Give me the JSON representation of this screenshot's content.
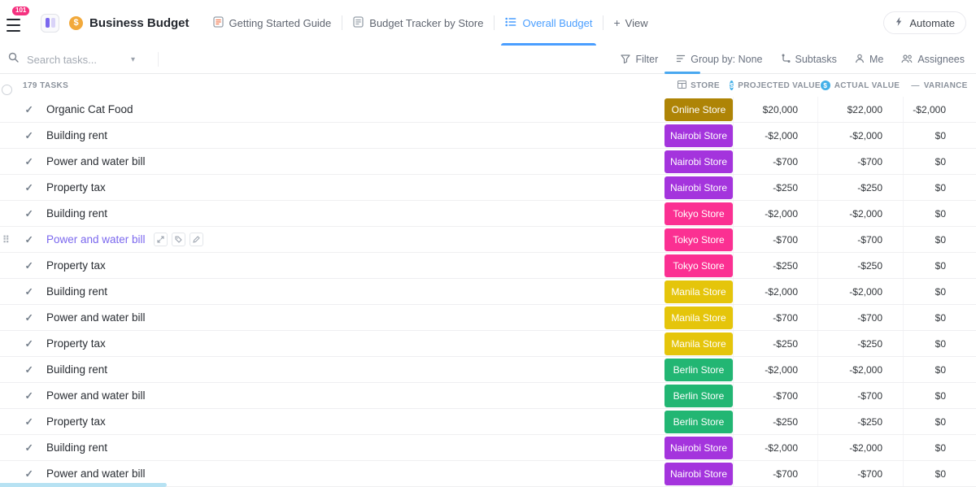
{
  "topbar": {
    "notifications_badge": "101",
    "workspace_title": "Business Budget",
    "tabs": [
      {
        "label": "Getting Started Guide"
      },
      {
        "label": "Budget Tracker by Store"
      },
      {
        "label": "Overall Budget"
      }
    ],
    "view_label": "View",
    "automate_label": "Automate"
  },
  "toolbar": {
    "search_placeholder": "Search tasks...",
    "filter_label": "Filter",
    "group_by_label": "Group by: None",
    "subtasks_label": "Subtasks",
    "me_label": "Me",
    "assignees_label": "Assignees"
  },
  "table": {
    "tasks_count": "179 TASKS",
    "columns": {
      "store": "STORE",
      "projected": "PROJECTED VALUE",
      "actual": "ACTUAL VALUE",
      "variance": "VARIANCE"
    },
    "rows": [
      {
        "name": "Organic Cat Food",
        "store": "Online Store",
        "projected": "$20,000",
        "actual": "$22,000",
        "variance": "-$2,000"
      },
      {
        "name": "Building rent",
        "store": "Nairobi Store",
        "projected": "-$2,000",
        "actual": "-$2,000",
        "variance": "$0"
      },
      {
        "name": "Power and water bill",
        "store": "Nairobi Store",
        "projected": "-$700",
        "actual": "-$700",
        "variance": "$0"
      },
      {
        "name": "Property tax",
        "store": "Nairobi Store",
        "projected": "-$250",
        "actual": "-$250",
        "variance": "$0"
      },
      {
        "name": "Building rent",
        "store": "Tokyo Store",
        "projected": "-$2,000",
        "actual": "-$2,000",
        "variance": "$0"
      },
      {
        "name": "Power and water bill",
        "store": "Tokyo Store",
        "projected": "-$700",
        "actual": "-$700",
        "variance": "$0",
        "highlighted": true
      },
      {
        "name": "Property tax",
        "store": "Tokyo Store",
        "projected": "-$250",
        "actual": "-$250",
        "variance": "$0"
      },
      {
        "name": "Building rent",
        "store": "Manila Store",
        "projected": "-$2,000",
        "actual": "-$2,000",
        "variance": "$0"
      },
      {
        "name": "Power and water bill",
        "store": "Manila Store",
        "projected": "-$700",
        "actual": "-$700",
        "variance": "$0"
      },
      {
        "name": "Property tax",
        "store": "Manila Store",
        "projected": "-$250",
        "actual": "-$250",
        "variance": "$0"
      },
      {
        "name": "Building rent",
        "store": "Berlin Store",
        "projected": "-$2,000",
        "actual": "-$2,000",
        "variance": "$0"
      },
      {
        "name": "Power and water bill",
        "store": "Berlin Store",
        "projected": "-$700",
        "actual": "-$700",
        "variance": "$0"
      },
      {
        "name": "Property tax",
        "store": "Berlin Store",
        "projected": "-$250",
        "actual": "-$250",
        "variance": "$0"
      },
      {
        "name": "Building rent",
        "store": "Nairobi Store",
        "projected": "-$2,000",
        "actual": "-$2,000",
        "variance": "$0"
      },
      {
        "name": "Power and water bill",
        "store": "Nairobi Store",
        "projected": "-$700",
        "actual": "-$700",
        "variance": "$0"
      }
    ]
  },
  "store_colors": {
    "Online Store": "#ae8406",
    "Nairobi Store": "#a434dd",
    "Tokyo Store": "#fb3092",
    "Manila Store": "#e5c50b",
    "Berlin Store": "#22b673"
  },
  "icons": {
    "check": "✓",
    "chevron_down": "▾",
    "plus": "+",
    "dollar": "$",
    "dash": "—",
    "money_bag": "$",
    "drag_handle": "⠿"
  },
  "colors": {
    "accent_blue": "#4a9eff",
    "brand_purple": "#7b68ee",
    "notification_pink": "#f5317f"
  }
}
